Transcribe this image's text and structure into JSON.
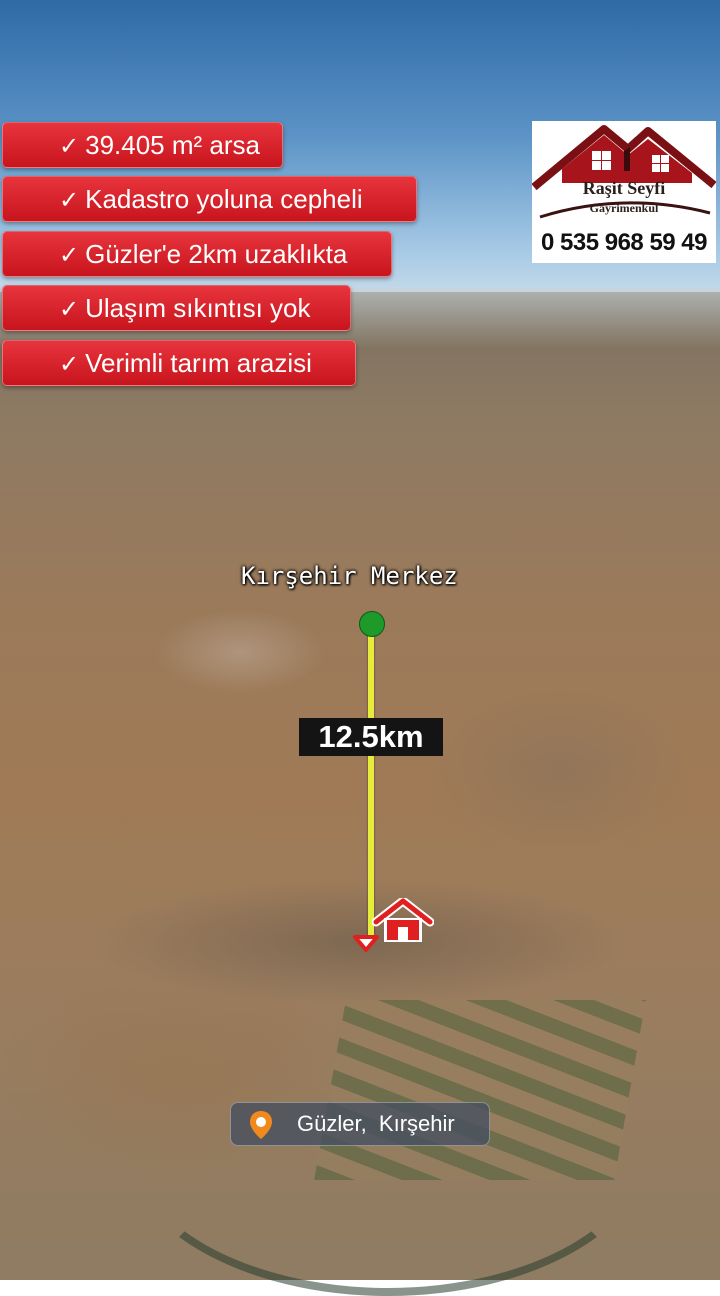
{
  "features": [
    {
      "text": "39.405 m² arsa"
    },
    {
      "text": "Kadastro yoluna cepheli"
    },
    {
      "text": "Güzler'e 2km uzaklıkta"
    },
    {
      "text": "Ulaşım sıkıntısı yok"
    },
    {
      "text": "Verimli tarım arazisi"
    }
  ],
  "check_glyph": "✓",
  "logo": {
    "company": "Raşit Seyfi",
    "subtitle": "Gayrimenkul",
    "phone": "0 535 968 59 49"
  },
  "map": {
    "origin_label": "Kırşehir Merkez",
    "distance": "12.5km",
    "line_color": "#e6ec3b",
    "origin_marker_color": "#1e9a2a",
    "destination_marker_color": "#e02020",
    "location": "Güzler,  Kırşehir",
    "location_icon": "map-pin-icon"
  }
}
